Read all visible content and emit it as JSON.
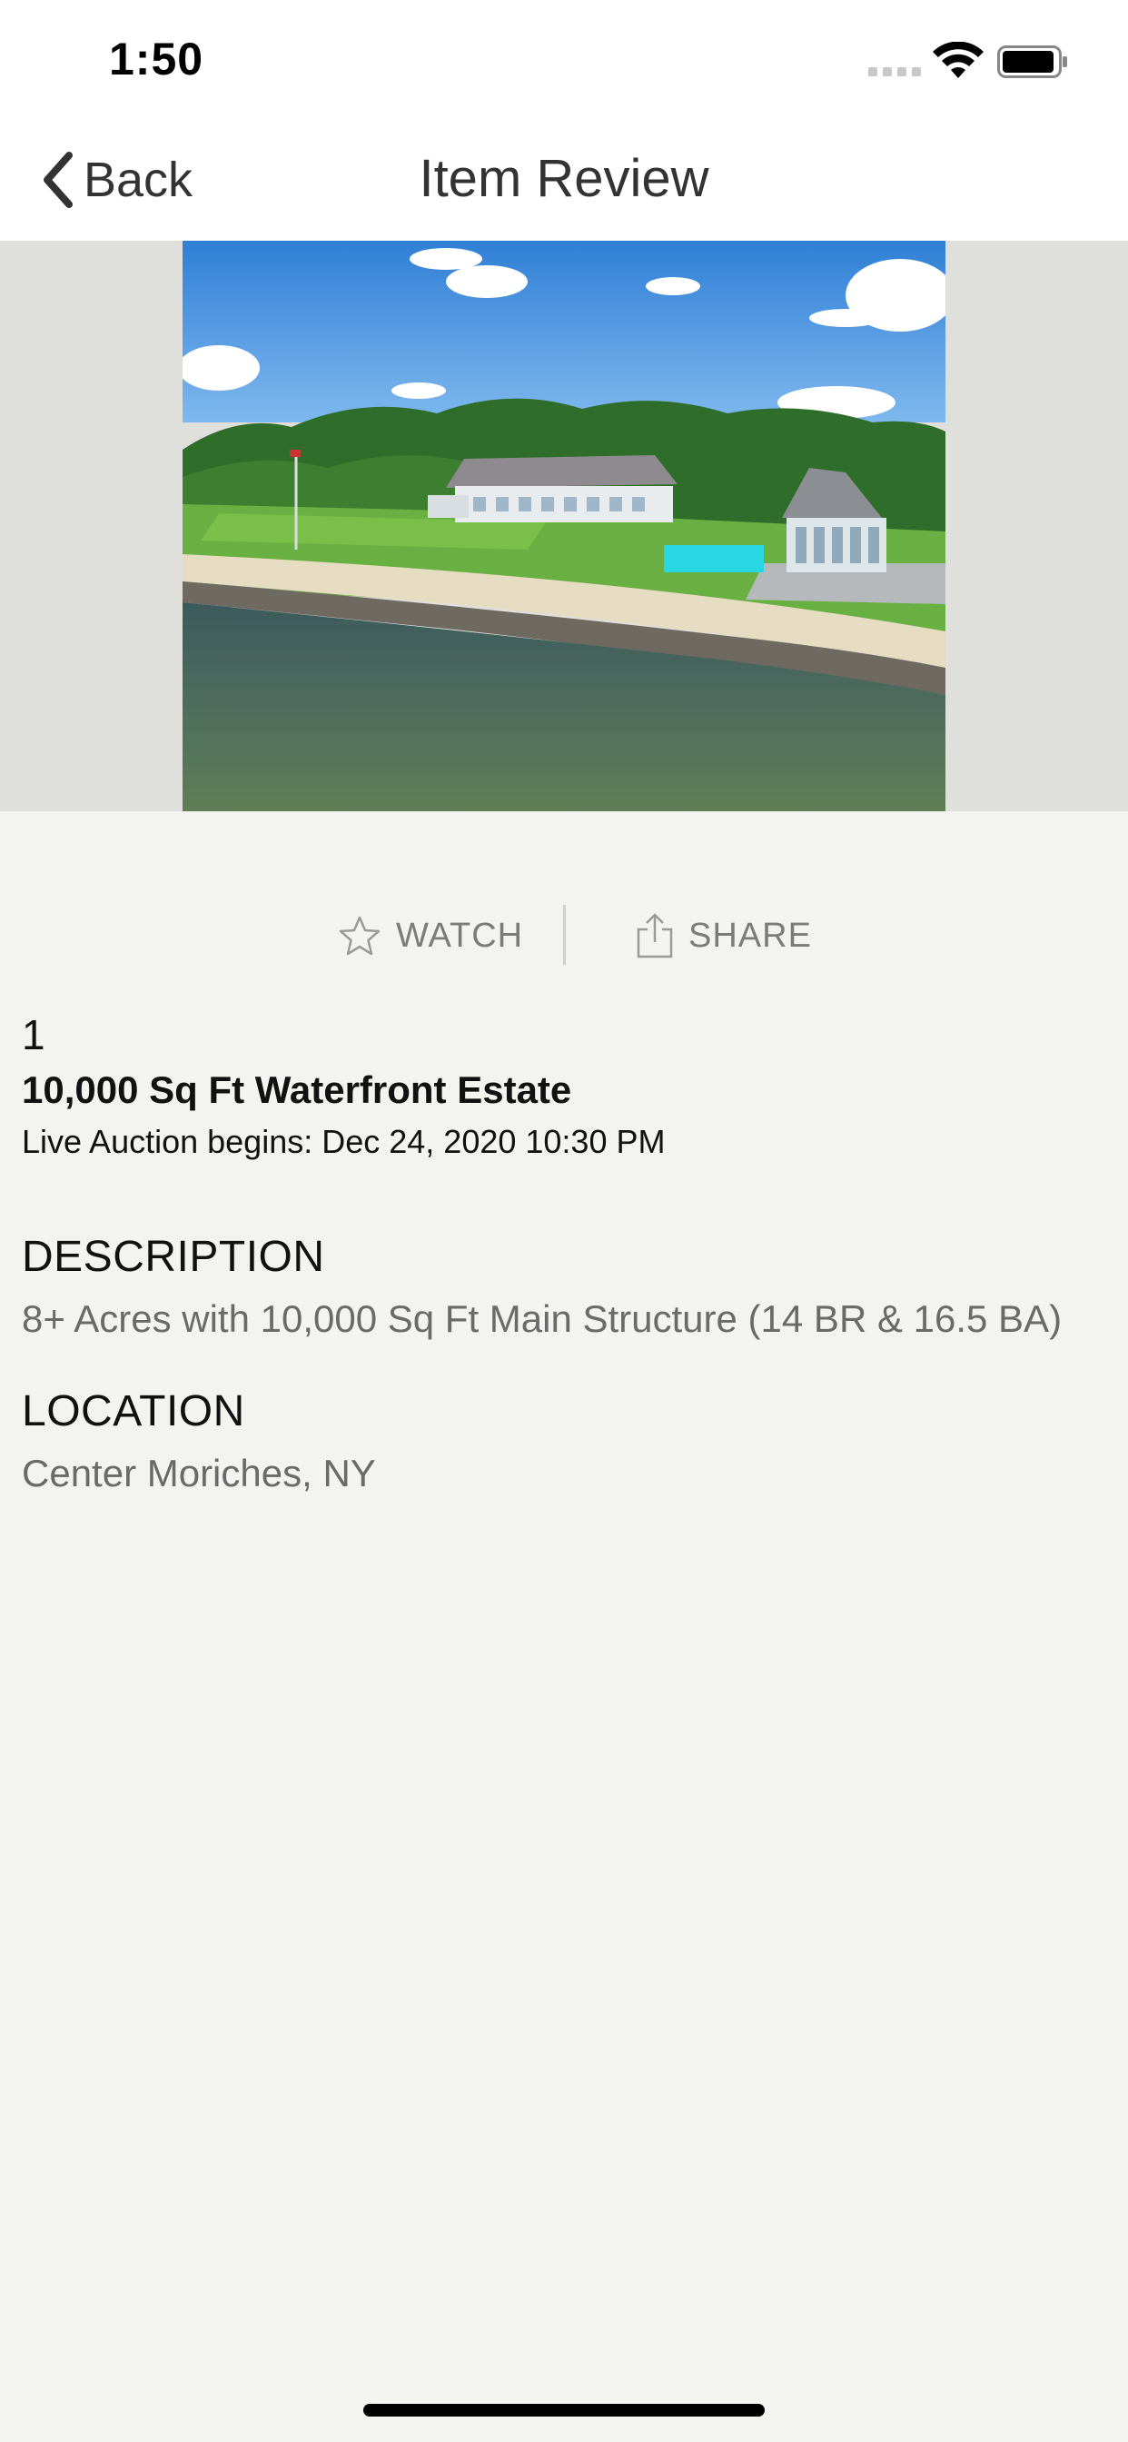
{
  "status_bar": {
    "time": "1:50"
  },
  "nav": {
    "back_label": "Back",
    "title": "Item Review"
  },
  "hero": {
    "image": "aerial-waterfront-estate-photo"
  },
  "actions": {
    "watch_label": "WATCH",
    "share_label": "SHARE"
  },
  "item": {
    "lot_number": "1",
    "title": "10,000 Sq Ft Waterfront Estate",
    "auction_begins": "Live Auction begins: Dec 24, 2020 10:30 PM"
  },
  "description": {
    "heading": "DESCRIPTION",
    "text": "8+ Acres with 10,000 Sq Ft Main Structure (14 BR & 16.5 BA)"
  },
  "location": {
    "heading": "LOCATION",
    "text": "Center Moriches, NY"
  },
  "colors": {
    "background": "#f3f3ef",
    "bar_background": "#ffffff",
    "muted_text": "#7b7b7b"
  }
}
